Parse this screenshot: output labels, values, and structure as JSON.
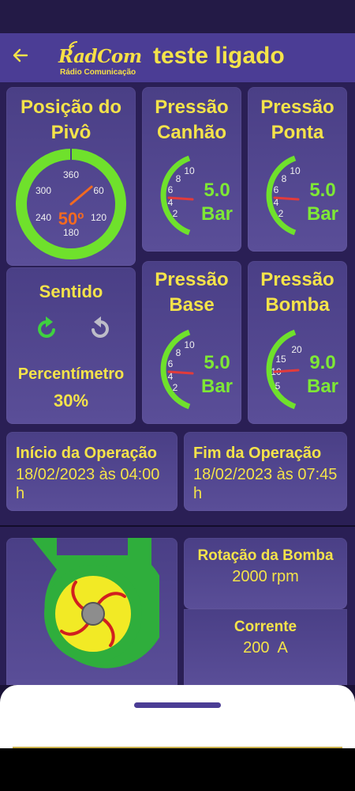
{
  "header": {
    "title": "teste ligado",
    "back_icon": "arrow-left-icon",
    "logo_name": "RadCom",
    "logo_sub": "Rádio Comunicação"
  },
  "pivot": {
    "title_line1": "Posição do",
    "title_line2": "Pivô",
    "value": "50º",
    "angle_deg": 50,
    "ticks": [
      "360",
      "60",
      "120",
      "180",
      "240",
      "300"
    ]
  },
  "pressures": [
    {
      "title_line1": "Pressão",
      "title_line2": "Canhão",
      "value": "5.0",
      "unit": "Bar",
      "ticks": [
        "2",
        "4",
        "6",
        "8",
        "10"
      ]
    },
    {
      "title_line1": "Pressão",
      "title_line2": "Ponta",
      "value": "5.0",
      "unit": "Bar",
      "ticks": [
        "2",
        "4",
        "6",
        "8",
        "10"
      ]
    },
    {
      "title_line1": "Pressão",
      "title_line2": "Base",
      "value": "5.0",
      "unit": "Bar",
      "ticks": [
        "2",
        "4",
        "6",
        "8",
        "10"
      ]
    },
    {
      "title_line1": "Pressão",
      "title_line2": "Bomba",
      "value": "9.0",
      "unit": "Bar",
      "ticks": [
        "5",
        "10",
        "15",
        "20"
      ]
    }
  ],
  "direction": {
    "label": "Sentido",
    "clockwise_icon": "rotate-clockwise-icon",
    "counterclockwise_icon": "rotate-counterclockwise-icon",
    "active_color": "#3fd13f",
    "inactive_color": "#bdbdc8"
  },
  "percent": {
    "label": "Percentímetro",
    "value": "30%"
  },
  "operation": {
    "start_title": "Início da Operação",
    "start_text": "18/02/2023 às 04:00 h",
    "end_title": "Fim da Operação",
    "end_text": "18/02/2023 às 07:45 h"
  },
  "pump": {
    "icon": "pump-icon",
    "rotation_title": "Rotação da Bomba",
    "rotation_value": "2000 rpm",
    "current_title": "Corrente",
    "current_value": "200  A"
  },
  "colors": {
    "accent_yellow": "#f4e34a",
    "gauge_green": "#6fe12c",
    "needle_red": "#e23b3b",
    "pivot_value_orange": "#f26a21"
  }
}
